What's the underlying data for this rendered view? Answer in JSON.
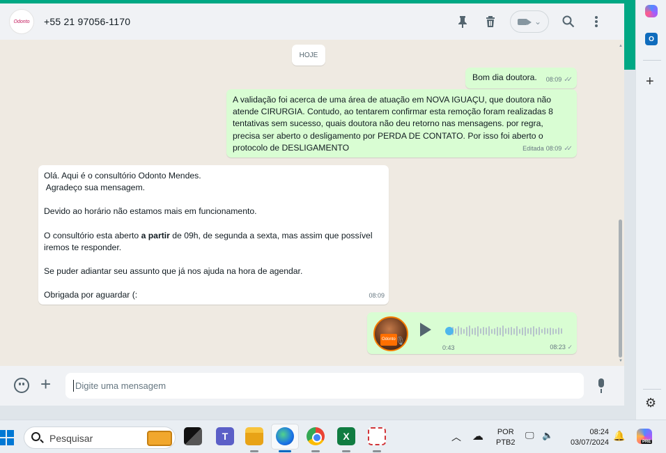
{
  "header": {
    "avatar_logo": "Odonto",
    "contact_name": "+55 21 97056-1170",
    "icons": [
      "pin-icon",
      "trash-icon",
      "video-call-icon",
      "search-icon",
      "menu-icon"
    ]
  },
  "chat": {
    "date_chip": "HOJE",
    "messages": [
      {
        "direction": "out",
        "lines": [
          "Bom dia doutora."
        ],
        "time": "08:09",
        "status": "read"
      },
      {
        "direction": "out",
        "lines": [
          "A validação foi acerca de uma área de atuação em NOVA IGUAÇU, que doutora não",
          "atende CIRURGIA. Contudo, ao tentarem confirmar esta remoção foram realizadas 8",
          "tentativas sem sucesso, quais doutora não deu retorno nas mensagens. por regra,",
          "precisa ser aberto o desligamento por PERDA DE CONTATO. Por isso foi aberto o",
          "protocolo de DESLIGAMENTO"
        ],
        "edited_label": "Editada",
        "time": "08:09",
        "status": "read"
      },
      {
        "direction": "in",
        "p1": "Olá. Aqui é o consultório  Odonto Mendes.",
        "p2": " Agradeço sua mensagem.",
        "p3": "Devido ao horário não estamos mais em funcionamento.",
        "p4_pre": "O consultório esta aberto ",
        "p4_bold": "a partir",
        "p4_post": " de 09h, de segunda a sexta, mas assim que possível",
        "p5": "iremos te responder.",
        "p6": "Se puder adiantar seu assunto que já nos ajuda na hora de agendar.",
        "p7": "Obrigada por aguardar (:",
        "time": "08:09"
      },
      {
        "direction": "out",
        "type": "voice",
        "avatar_label": "Odonto",
        "duration": "0:43",
        "time": "08:23",
        "status": "delivered"
      }
    ]
  },
  "footer": {
    "placeholder": "Digite uma mensagem"
  },
  "sidepanel": {
    "outlook_label": "O"
  },
  "taskbar": {
    "search_placeholder": "Pesquisar",
    "teams_label": "T",
    "excel_label": "X",
    "lang_line1": "POR",
    "lang_line2": "PTB2",
    "time": "08:24",
    "date": "03/07/2024",
    "copilot_badge": "PRE"
  },
  "colors": {
    "accent": "#00a884",
    "outgoing_bubble": "#d9fdd3",
    "incoming_bubble": "#ffffff",
    "chat_background": "#efeae2"
  }
}
